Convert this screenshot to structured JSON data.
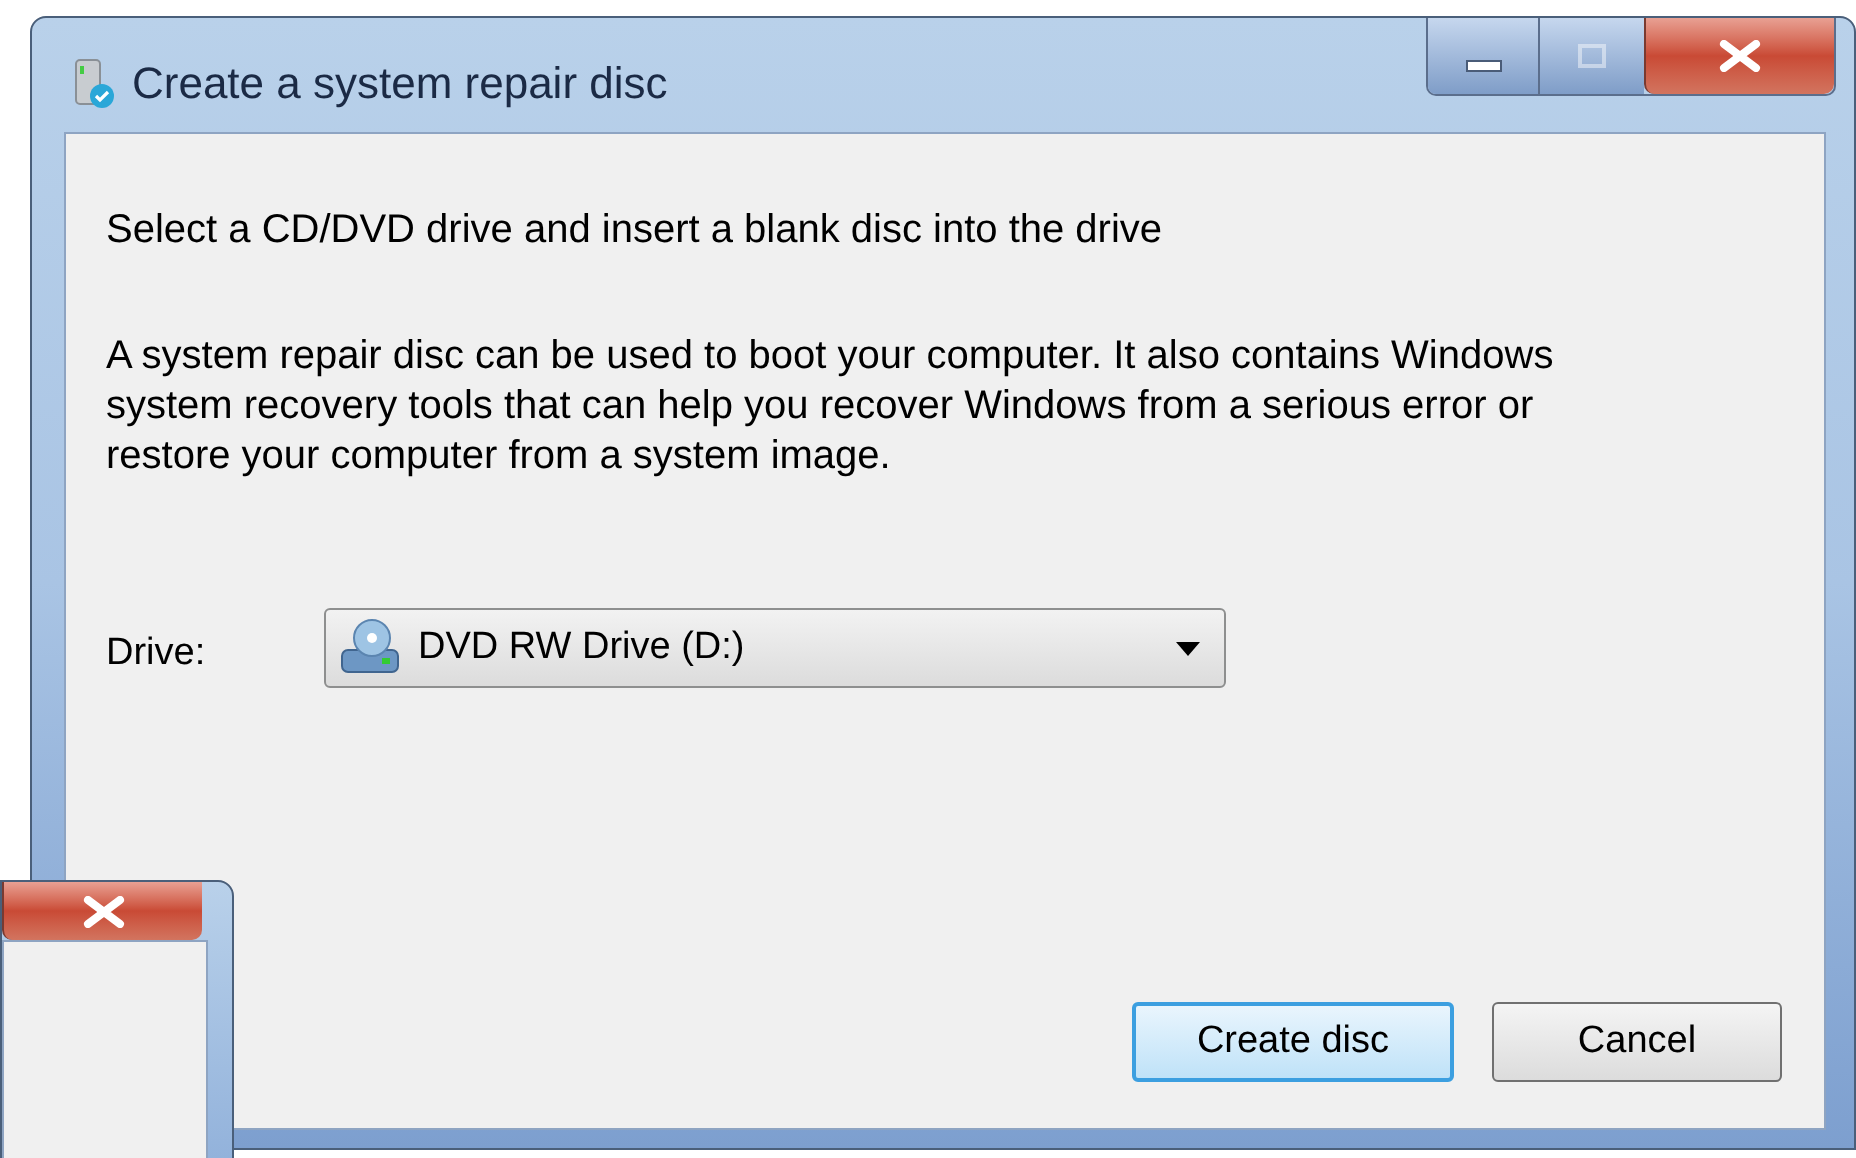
{
  "window": {
    "title": "Create a system repair disc",
    "title_buttons": [
      {
        "kind": "minimize"
      },
      {
        "kind": "maximize",
        "disabled": true
      },
      {
        "kind": "close"
      }
    ]
  },
  "heading": "Select a CD/DVD drive and insert a blank disc into the drive",
  "description": "A system repair disc can be used to boot your computer. It also contains Windows system recovery tools that can help you recover Windows from a serious error or restore your computer from a system image.",
  "drive": {
    "label": "Drive:",
    "value": "DVD RW Drive (D:)"
  },
  "buttons": [
    {
      "label": "Create disc",
      "default": true
    },
    {
      "label": "Cancel",
      "default": false
    }
  ],
  "background_window": {
    "title_buttons": [
      {
        "kind": "close"
      }
    ]
  }
}
